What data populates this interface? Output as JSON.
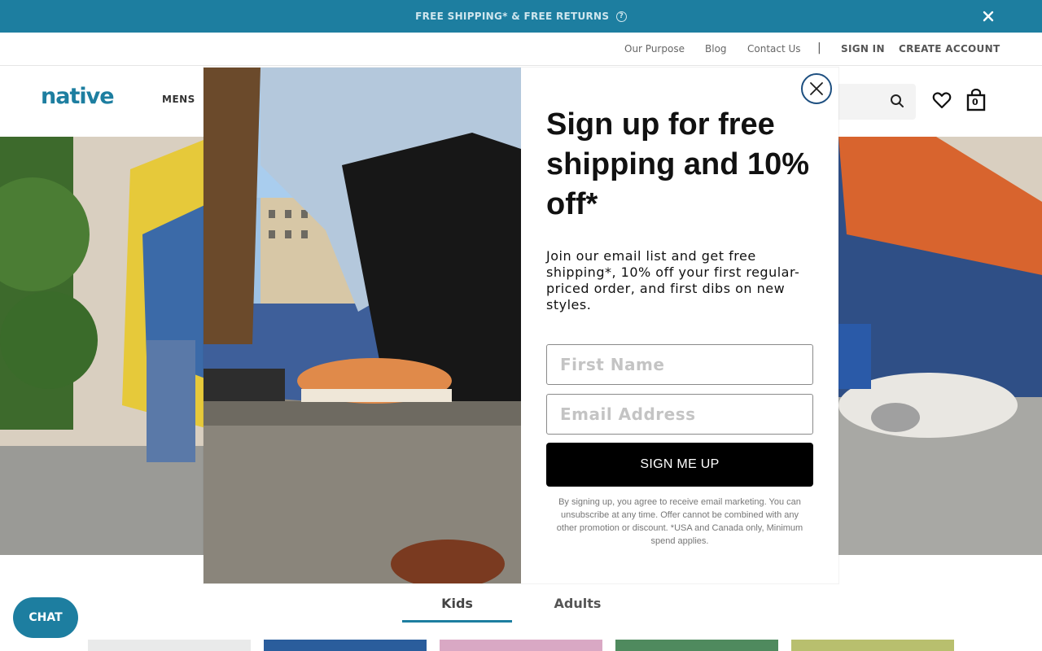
{
  "promo": {
    "text": "FREE SHIPPING* & FREE RETURNS",
    "help_glyph": "?"
  },
  "utility_nav": {
    "our_purpose": "Our Purpose",
    "blog": "Blog",
    "contact_us": "Contact Us",
    "separator": "|",
    "sign_in": "SIGN IN",
    "create_account": "CREATE ACCOUNT"
  },
  "header": {
    "logo": "native",
    "nav_mens": "MENS",
    "bag_count": "0"
  },
  "tabs": {
    "kids": "Kids",
    "adults": "Adults"
  },
  "chat": {
    "label": "CHAT"
  },
  "modal": {
    "headline": "Sign up for free shipping and 10% off*",
    "subtext": "Join our email list and get free shipping*, 10% off your first regular-priced order, and first dibs on new styles.",
    "first_name_placeholder": "First Name",
    "email_placeholder": "Email Address",
    "submit_label": "SIGN ME UP",
    "fine_print": "By signing up, you agree to receive email marketing. You can unsubscribe at any time. Offer cannot be combined with any other promotion or discount. *USA and Canada only, Minimum spend applies."
  },
  "colors": {
    "brand": "#1d7ea0",
    "modal_close_ring": "#1d4f80",
    "button": "#000000"
  },
  "icons": [
    "close-icon",
    "help-icon",
    "search-icon",
    "heart-icon",
    "bag-icon",
    "close-circle-icon"
  ]
}
